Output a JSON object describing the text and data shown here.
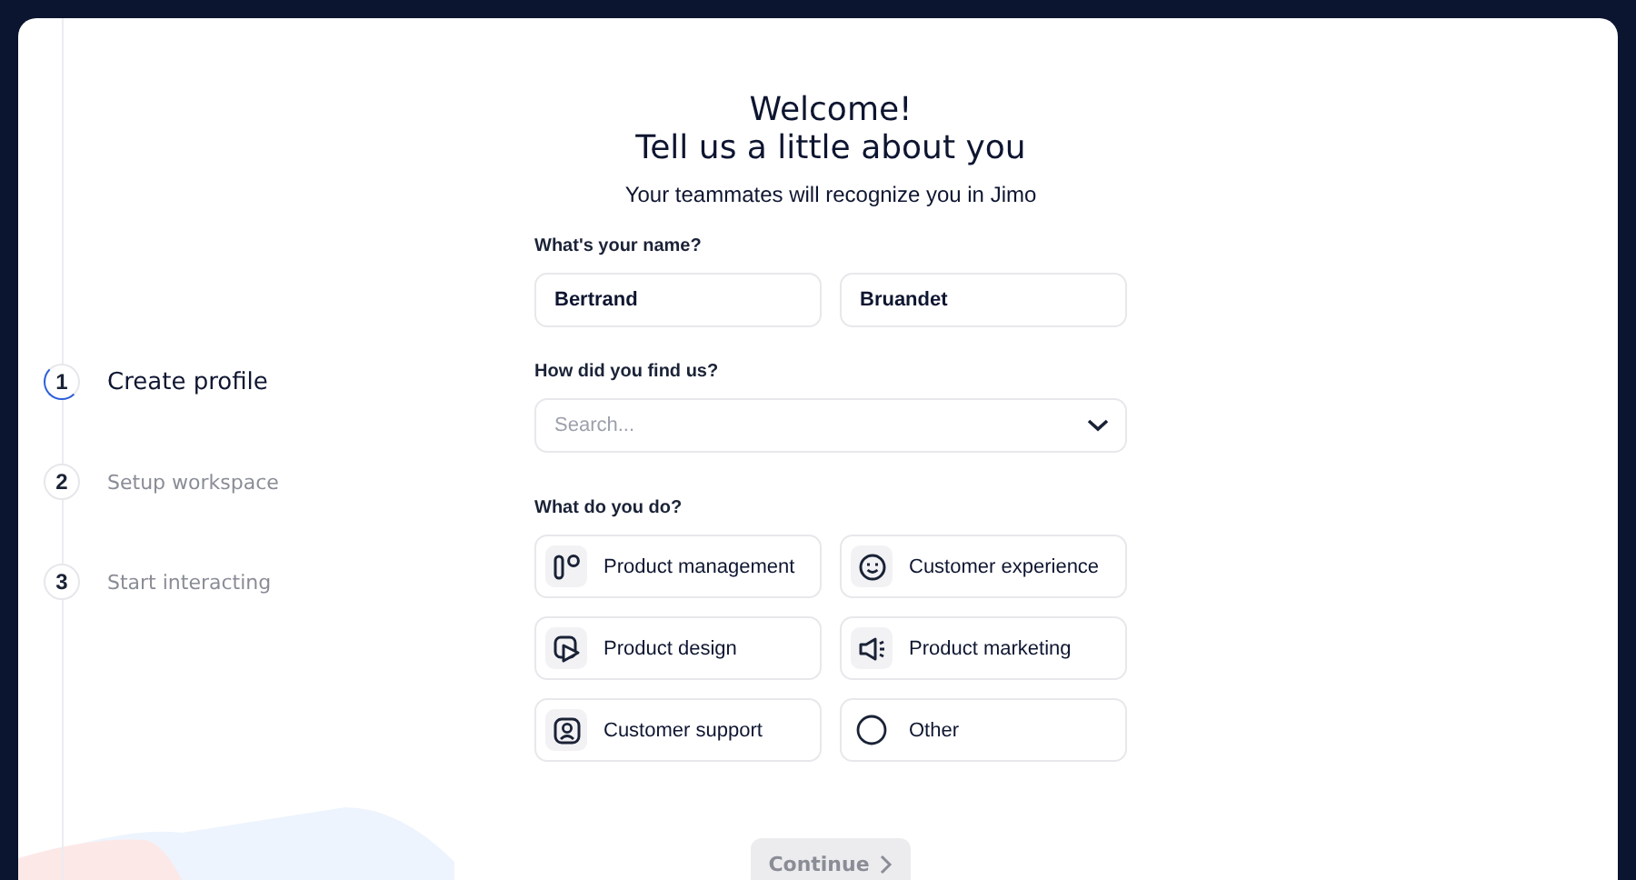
{
  "steps": [
    {
      "number": "1",
      "label": "Create profile",
      "selected": true
    },
    {
      "number": "2",
      "label": "Setup workspace",
      "selected": false
    },
    {
      "number": "3",
      "label": "Start interacting",
      "selected": false
    }
  ],
  "header": {
    "title_line_1": "Welcome!",
    "title_line_2": "Tell us a little about you",
    "subtitle": "Your teammates will recognize you in Jimo"
  },
  "name_section": {
    "label": "What's your name?",
    "first_name": "Bertrand",
    "last_name": "Bruandet"
  },
  "source_section": {
    "label": "How did you find us?",
    "placeholder": "Search..."
  },
  "role_section": {
    "label": "What do you do?",
    "options": [
      {
        "kind": "management",
        "label": "Product management"
      },
      {
        "kind": "experience",
        "label": "Customer experience"
      },
      {
        "kind": "design",
        "label": "Product design"
      },
      {
        "kind": "marketing",
        "label": "Product marketing"
      },
      {
        "kind": "support",
        "label": "Customer support"
      },
      {
        "kind": "other",
        "label": "Other"
      }
    ]
  },
  "continue_button": {
    "label": "Continue",
    "disabled": true
  }
}
